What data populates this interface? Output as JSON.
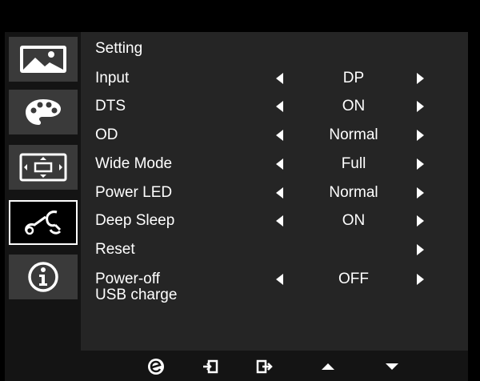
{
  "menu": {
    "title": "Setting",
    "tabs": [
      {
        "icon": "picture-icon",
        "active": false
      },
      {
        "icon": "color-palette-icon",
        "active": false
      },
      {
        "icon": "display-size-icon",
        "active": false
      },
      {
        "icon": "settings-tools-icon",
        "active": true
      },
      {
        "icon": "info-icon",
        "active": false
      }
    ],
    "rows": [
      {
        "label": "Input",
        "value": "DP",
        "has_left": true,
        "has_right": true
      },
      {
        "label": "DTS",
        "value": "ON",
        "has_left": true,
        "has_right": true
      },
      {
        "label": "OD",
        "value": "Normal",
        "has_left": true,
        "has_right": true
      },
      {
        "label": "Wide Mode",
        "value": "Full",
        "has_left": true,
        "has_right": true
      },
      {
        "label": "Power LED",
        "value": "Normal",
        "has_left": true,
        "has_right": true
      },
      {
        "label": "Deep Sleep",
        "value": "ON",
        "has_left": true,
        "has_right": true
      },
      {
        "label": "Reset",
        "value": "",
        "has_left": false,
        "has_right": true
      },
      {
        "label": "Power-off",
        "label_line2": "USB charge",
        "value": "OFF",
        "has_left": true,
        "has_right": true
      }
    ]
  },
  "bottom_buttons": [
    "e-key-icon",
    "enter-icon",
    "exit-icon",
    "up-arrow-icon",
    "down-arrow-icon"
  ],
  "colors": {
    "background": "#000000",
    "panel": "#252525",
    "sidebar": "#141414",
    "tab": "#3a3a3a",
    "text": "#ffffff"
  }
}
